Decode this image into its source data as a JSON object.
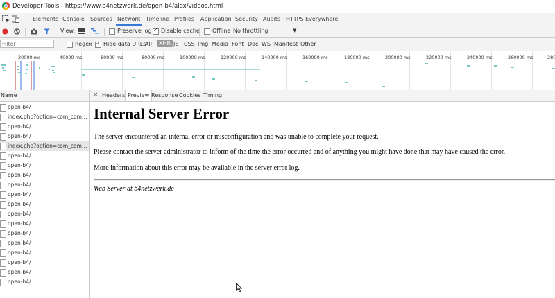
{
  "window": {
    "title": "Developer Tools - https://www.b4netzwerk.de/open-b4/alex/videos.html"
  },
  "panel_tabs": [
    "Elements",
    "Console",
    "Sources",
    "Network",
    "Timeline",
    "Profiles",
    "Application",
    "Security",
    "Audits",
    "HTTPS Everywhere"
  ],
  "active_panel": "Network",
  "toolbar": {
    "view_label": "View:",
    "preserve_log": "Preserve log",
    "disable_cache": "Disable cache",
    "offline": "Offline",
    "throttling": "No throttling"
  },
  "filter": {
    "placeholder": "Filter",
    "regex": "Regex",
    "hide_data_urls": "Hide data URLs",
    "types": [
      "All",
      "XHR",
      "JS",
      "CSS",
      "Img",
      "Media",
      "Font",
      "Doc",
      "WS",
      "Manifest",
      "Other"
    ],
    "selected_type": "XHR"
  },
  "timeline": {
    "labels": [
      "20000 ms",
      "40000 ms",
      "60000 ms",
      "80000 ms",
      "100000 ms",
      "120000 ms",
      "140000 ms",
      "160000 ms",
      "180000 ms",
      "200000 ms",
      "220000 ms",
      "240000 ms",
      "260000 ms",
      "280"
    ]
  },
  "request_list": {
    "header": "Name",
    "items": [
      "open-b4/",
      "index.php?option=com_communi...",
      "open-b4/",
      "open-b4/",
      "index.php?option=com_communi...",
      "open-b4/",
      "open-b4/",
      "open-b4/",
      "open-b4/",
      "open-b4/",
      "open-b4/",
      "open-b4/",
      "open-b4/",
      "open-b4/",
      "open-b4/",
      "open-b4/",
      "open-b4/",
      "open-b4/",
      "open-b4/"
    ],
    "selected_index": 4
  },
  "detail_tabs": [
    "Headers",
    "Preview",
    "Response",
    "Cookies",
    "Timing"
  ],
  "active_detail_tab": "Preview",
  "preview": {
    "title": "Internal Server Error",
    "p1": "The server encountered an internal error or misconfiguration and was unable to complete your request.",
    "p2": "Please contact the server administrator to inform of the time the error occurred and of anything you might have done that may have caused the error.",
    "p3": "More information about this error may be available in the server error log.",
    "address": "Web Server at b4netzwerk.de"
  },
  "colors": {
    "accent": "#3879d9",
    "record": "#d92e2e",
    "timeline_bar": "#1aa39a"
  }
}
